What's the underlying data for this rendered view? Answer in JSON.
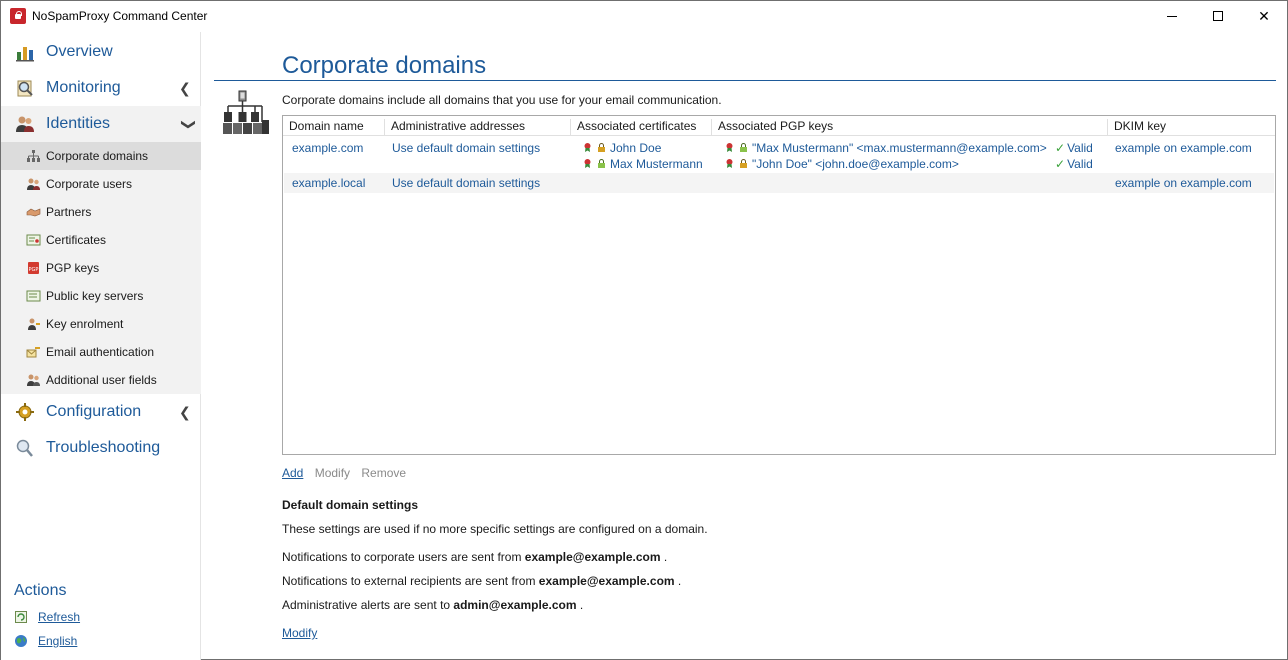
{
  "window": {
    "title": "NoSpamProxy Command Center"
  },
  "nav": {
    "overview": "Overview",
    "monitoring": "Monitoring",
    "identities": "Identities",
    "configuration": "Configuration",
    "troubleshooting": "Troubleshooting",
    "identities_items": [
      "Corporate domains",
      "Corporate users",
      "Partners",
      "Certificates",
      "PGP keys",
      "Public key servers",
      "Key enrolment",
      "Email authentication",
      "Additional user fields"
    ]
  },
  "actions": {
    "title": "Actions",
    "refresh": "Refresh",
    "english": "English"
  },
  "page": {
    "title": "Corporate domains",
    "intro": "Corporate domains include all domains that you use for your email communication."
  },
  "grid": {
    "headers": [
      "Domain name",
      "Administrative addresses",
      "Associated certificates",
      "Associated PGP keys",
      "DKIM key"
    ],
    "rows": [
      {
        "domain": "example.com",
        "admin": "Use default domain settings",
        "certs": [
          "John Doe",
          "Max Mustermann"
        ],
        "pgp": [
          "\"Max Mustermann\" <max.mustermann@example.com>",
          "\"John Doe\" <john.doe@example.com>"
        ],
        "pgp_status": [
          "Valid",
          "Valid"
        ],
        "dkim": "example on example.com"
      },
      {
        "domain": "example.local",
        "admin": "Use default domain settings",
        "dkim": "example on example.com"
      }
    ]
  },
  "grid_actions": {
    "add": "Add",
    "modify": "Modify",
    "remove": "Remove"
  },
  "defaults": {
    "title": "Default domain settings",
    "desc": "These settings are used if no more specific settings are configured on a domain.",
    "corp_prefix": "Notifications to corporate users are sent from",
    "corp_addr": "example@example.com",
    "ext_prefix": "Notifications to external recipients are sent from",
    "ext_addr": "example@example.com",
    "alert_prefix": "Administrative alerts are sent to",
    "alert_addr": "admin@example.com",
    "period": ".",
    "modify": "Modify"
  },
  "colors": {
    "accent": "#1e5a99",
    "valid": "#3aa23a",
    "selected": "#dcdcdc"
  }
}
